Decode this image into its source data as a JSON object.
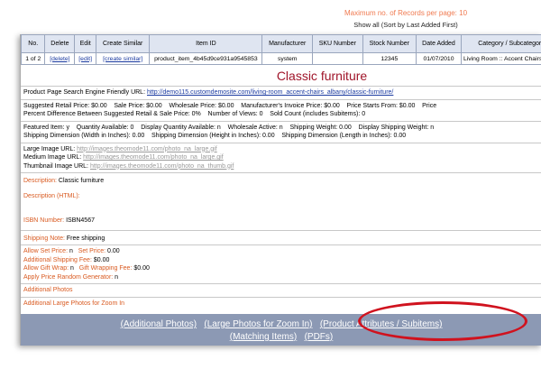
{
  "top": {
    "max_records": "Maximum no. of Records per page: 10",
    "show_all": "Show all (Sort by Last Added First)"
  },
  "table": {
    "headers": [
      "No.",
      "Delete",
      "Edit",
      "Create Similar",
      "Item ID",
      "Manufacturer",
      "SKU Number",
      "Stock Number",
      "Date Added",
      "Category / Subcategory"
    ],
    "row": {
      "no": "1 of 2",
      "delete": "[delete]",
      "edit": "[edit]",
      "create_similar": "[create similar]",
      "item_id": "product_item_4b45d9ce931a9545853",
      "manufacturer": "system",
      "sku": "",
      "stock": "12345",
      "date_added": "01/07/2010",
      "category": "Living Room :: Accent Chairs"
    }
  },
  "product_title": "Classic furniture",
  "seo": {
    "label": "Product Page Search Engine Friendly URL:",
    "url": "http://demo115.customdemosite.com/living-room_accent-chairs_albany/classic-furniture/"
  },
  "prices_line1": "Suggested Retail Price: $0.00    Sale Price: $0.00    Wholesale Price: $0.00    Manufacturer's Invoice Price: $0.00    Price Starts From: $0.00    Price",
  "prices_line2": "Percent Difference Between Suggested Retail & Sale Price: 0%    Number of Views: 0    Sold Count (includes Subitems): 0",
  "featured_line1": "Featured Item: y    Quantity Available: 0    Display Quantity Available: n    Wholesale Active: n    Shipping Weight: 0.00    Display Shipping Weight: n",
  "featured_line2": "Shipping Dimension (Width in Inches): 0.00    Shipping Dimension (Height in Inches): 0.00    Shipping Dimension (Length in Inches): 0.00",
  "images": {
    "large_label": "Large Image URL:",
    "large_url": "http://images.theomode11.com/photo_na_large.gif",
    "medium_label": "Medium Image URL:",
    "medium_url": "http://images.theomode11.com/photo_na_large.gif",
    "thumb_label": "Thumbnail Image URL:",
    "thumb_url": "http://images.theomode11.com/photo_na_thumb.gif"
  },
  "description": {
    "label": "Description:",
    "value": "Classic furniture"
  },
  "description_html": {
    "label": "Description (HTML):"
  },
  "isbn": {
    "label": "ISBN Number:",
    "value": "ISBN4567"
  },
  "shipping_note": {
    "label": "Shipping Note:",
    "value": "Free shipping"
  },
  "options": {
    "allow_set_price_label": "Allow Set Price:",
    "allow_set_price": "n",
    "set_price_label": "Set Price:",
    "set_price": "0.00",
    "addl_shipping_label": "Additional Shipping Fee:",
    "addl_shipping": "$0.00",
    "gift_wrap_label": "Allow Gift Wrap:",
    "gift_wrap": "n",
    "gift_fee_label": "Gift Wrapping Fee:",
    "gift_fee": "$0.00",
    "random_label": "Apply Price Random Generator:",
    "random": "n"
  },
  "additional_photos": "Additional Photos",
  "additional_large_photos": "Additional Large Photos for Zoom In",
  "bottom_links": {
    "additional_photos": "(Additional Photos)",
    "large_photos": "(Large Photos for Zoom In)",
    "product_attributes": "(Product Attributes / Subitems)",
    "matching_items": "(Matching Items)",
    "pdfs": "(PDFs)"
  },
  "colors": {
    "accent_label": "#d95a20",
    "title": "#a0152a",
    "link": "#1a3aa0",
    "highlight_oval": "#d0121e",
    "bottom_bar": "#8c99b4"
  }
}
